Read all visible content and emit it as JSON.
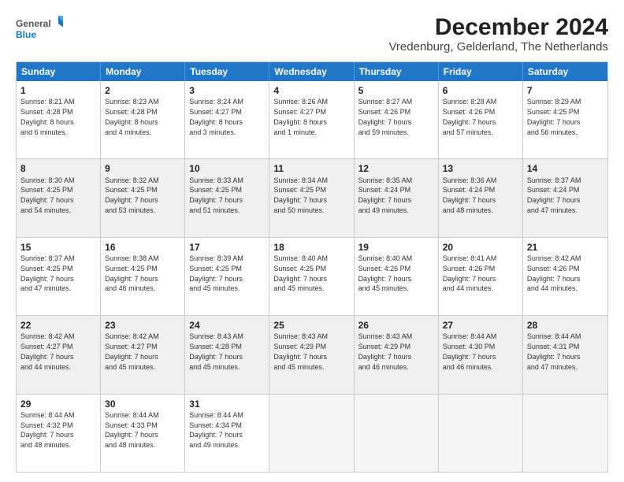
{
  "logo": {
    "general": "General",
    "blue": "Blue"
  },
  "title": "December 2024",
  "subtitle": "Vredenburg, Gelderland, The Netherlands",
  "days": [
    "Sunday",
    "Monday",
    "Tuesday",
    "Wednesday",
    "Thursday",
    "Friday",
    "Saturday"
  ],
  "weeks": [
    [
      {
        "num": "1",
        "rise": "8:21 AM",
        "set": "4:28 PM",
        "daylight": "8 hours and 6 minutes"
      },
      {
        "num": "2",
        "rise": "8:23 AM",
        "set": "4:28 PM",
        "daylight": "8 hours and 4 minutes"
      },
      {
        "num": "3",
        "rise": "8:24 AM",
        "set": "4:27 PM",
        "daylight": "8 hours and 3 minutes"
      },
      {
        "num": "4",
        "rise": "8:26 AM",
        "set": "4:27 PM",
        "daylight": "8 hours and 1 minute"
      },
      {
        "num": "5",
        "rise": "8:27 AM",
        "set": "4:26 PM",
        "daylight": "7 hours and 59 minutes"
      },
      {
        "num": "6",
        "rise": "8:28 AM",
        "set": "4:26 PM",
        "daylight": "7 hours and 57 minutes"
      },
      {
        "num": "7",
        "rise": "8:29 AM",
        "set": "4:25 PM",
        "daylight": "7 hours and 56 minutes"
      }
    ],
    [
      {
        "num": "8",
        "rise": "8:30 AM",
        "set": "4:25 PM",
        "daylight": "7 hours and 54 minutes"
      },
      {
        "num": "9",
        "rise": "8:32 AM",
        "set": "4:25 PM",
        "daylight": "7 hours and 53 minutes"
      },
      {
        "num": "10",
        "rise": "8:33 AM",
        "set": "4:25 PM",
        "daylight": "7 hours and 51 minutes"
      },
      {
        "num": "11",
        "rise": "8:34 AM",
        "set": "4:25 PM",
        "daylight": "7 hours and 50 minutes"
      },
      {
        "num": "12",
        "rise": "8:35 AM",
        "set": "4:24 PM",
        "daylight": "7 hours and 49 minutes"
      },
      {
        "num": "13",
        "rise": "8:36 AM",
        "set": "4:24 PM",
        "daylight": "7 hours and 48 minutes"
      },
      {
        "num": "14",
        "rise": "8:37 AM",
        "set": "4:24 PM",
        "daylight": "7 hours and 47 minutes"
      }
    ],
    [
      {
        "num": "15",
        "rise": "8:37 AM",
        "set": "4:25 PM",
        "daylight": "7 hours and 47 minutes"
      },
      {
        "num": "16",
        "rise": "8:38 AM",
        "set": "4:25 PM",
        "daylight": "7 hours and 46 minutes"
      },
      {
        "num": "17",
        "rise": "8:39 AM",
        "set": "4:25 PM",
        "daylight": "7 hours and 45 minutes"
      },
      {
        "num": "18",
        "rise": "8:40 AM",
        "set": "4:25 PM",
        "daylight": "7 hours and 45 minutes"
      },
      {
        "num": "19",
        "rise": "8:40 AM",
        "set": "4:26 PM",
        "daylight": "7 hours and 45 minutes"
      },
      {
        "num": "20",
        "rise": "8:41 AM",
        "set": "4:26 PM",
        "daylight": "7 hours and 44 minutes"
      },
      {
        "num": "21",
        "rise": "8:42 AM",
        "set": "4:26 PM",
        "daylight": "7 hours and 44 minutes"
      }
    ],
    [
      {
        "num": "22",
        "rise": "8:42 AM",
        "set": "4:27 PM",
        "daylight": "7 hours and 44 minutes"
      },
      {
        "num": "23",
        "rise": "8:42 AM",
        "set": "4:27 PM",
        "daylight": "7 hours and 45 minutes"
      },
      {
        "num": "24",
        "rise": "8:43 AM",
        "set": "4:28 PM",
        "daylight": "7 hours and 45 minutes"
      },
      {
        "num": "25",
        "rise": "8:43 AM",
        "set": "4:29 PM",
        "daylight": "7 hours and 45 minutes"
      },
      {
        "num": "26",
        "rise": "8:43 AM",
        "set": "4:29 PM",
        "daylight": "7 hours and 46 minutes"
      },
      {
        "num": "27",
        "rise": "8:44 AM",
        "set": "4:30 PM",
        "daylight": "7 hours and 46 minutes"
      },
      {
        "num": "28",
        "rise": "8:44 AM",
        "set": "4:31 PM",
        "daylight": "7 hours and 47 minutes"
      }
    ],
    [
      {
        "num": "29",
        "rise": "8:44 AM",
        "set": "4:32 PM",
        "daylight": "7 hours and 48 minutes"
      },
      {
        "num": "30",
        "rise": "8:44 AM",
        "set": "4:33 PM",
        "daylight": "7 hours and 48 minutes"
      },
      {
        "num": "31",
        "rise": "8:44 AM",
        "set": "4:34 PM",
        "daylight": "7 hours and 49 minutes"
      },
      null,
      null,
      null,
      null
    ]
  ]
}
